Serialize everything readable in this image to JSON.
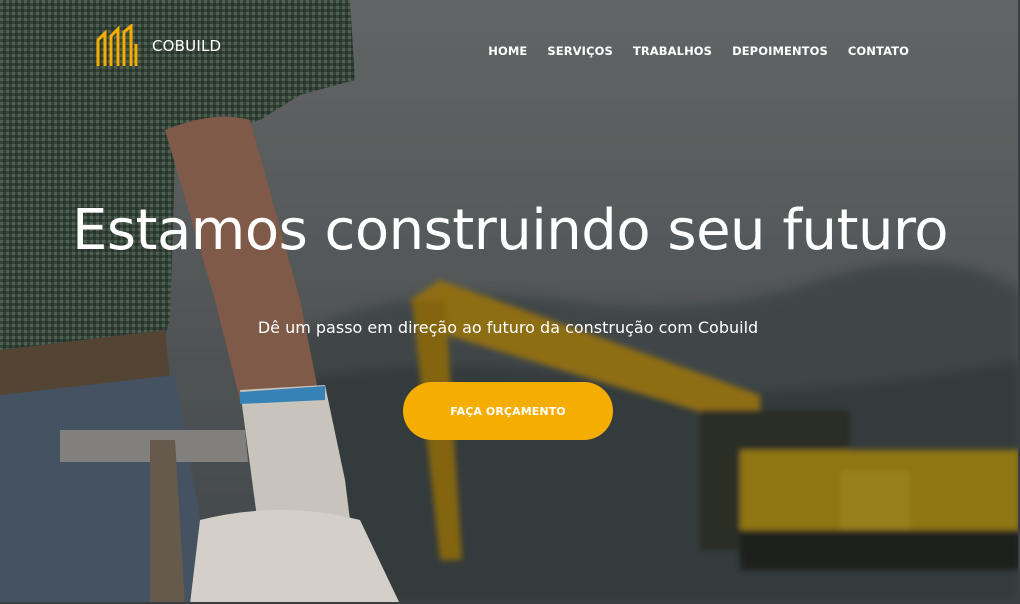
{
  "brand": {
    "name": "COBUILD",
    "accent_color": "#f4ad00",
    "logo_icon": "building-outline-icon"
  },
  "nav": {
    "items": [
      {
        "label": "HOME"
      },
      {
        "label": "SERVIÇOS"
      },
      {
        "label": "TRABALHOS"
      },
      {
        "label": "DEPOIMENTOS"
      },
      {
        "label": "CONTATO"
      }
    ]
  },
  "hero": {
    "title": "Estamos construindo seu futuro",
    "subtitle": "Dê um passo em direção ao futuro da construção com Cobuild",
    "cta_label": "FAÇA ORÇAMENTO",
    "background_image": "construction-worker-excavator-photo"
  }
}
